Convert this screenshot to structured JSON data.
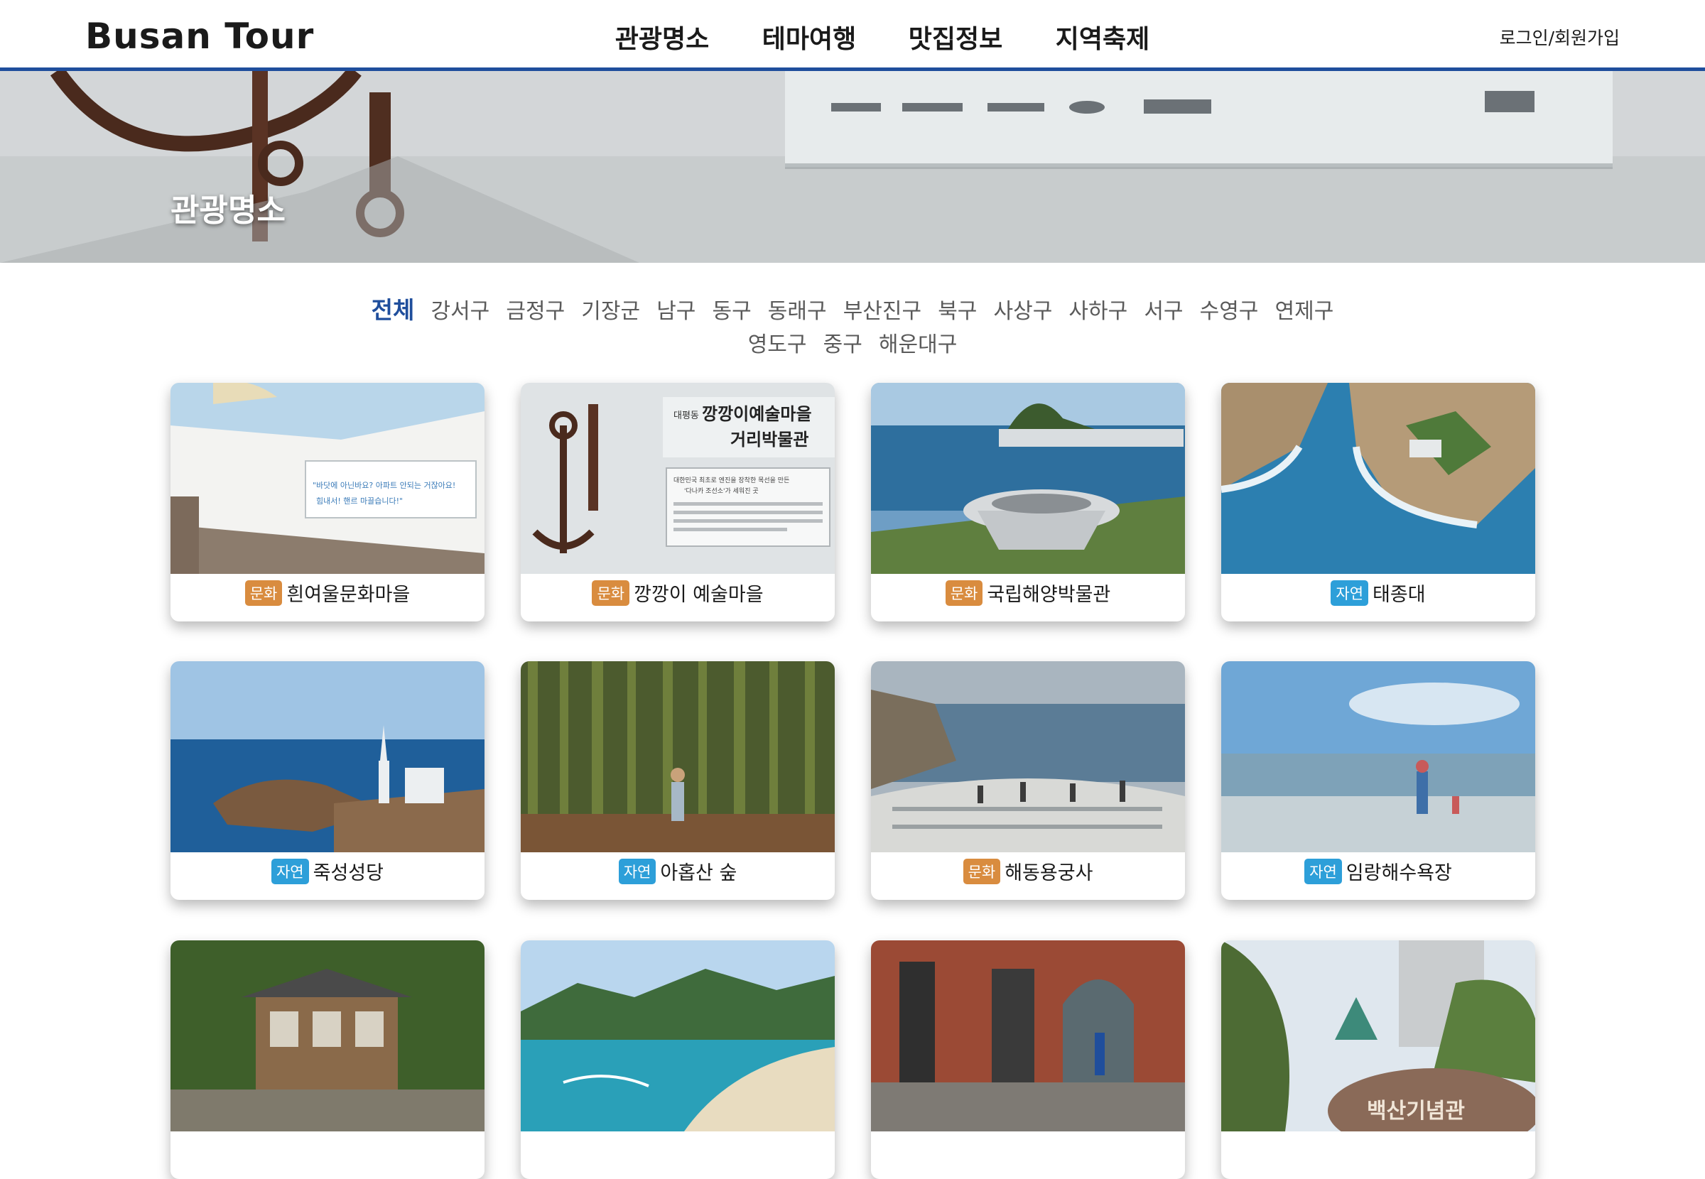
{
  "header": {
    "logo": "Busan Tour",
    "nav": [
      "관광명소",
      "테마여행",
      "맛집정보",
      "지역축제"
    ],
    "login": "로그인/회원가입"
  },
  "hero": {
    "title": "관광명소"
  },
  "filters": {
    "row1": [
      "전체",
      "강서구",
      "금정구",
      "기장군",
      "남구",
      "동구",
      "동래구",
      "부산진구",
      "북구",
      "사상구",
      "사하구",
      "서구",
      "수영구",
      "연제구"
    ],
    "row2": [
      "영도구",
      "중구",
      "해운대구"
    ],
    "active": "전체"
  },
  "places": [
    {
      "category": "문화",
      "name": "흰여울문화마을"
    },
    {
      "category": "문화",
      "name": "깡깡이 예술마을"
    },
    {
      "category": "문화",
      "name": "국립해양박물관"
    },
    {
      "category": "자연",
      "name": "태종대"
    },
    {
      "category": "자연",
      "name": "죽성성당"
    },
    {
      "category": "자연",
      "name": "아홉산 숲"
    },
    {
      "category": "문화",
      "name": "해동용궁사"
    },
    {
      "category": "자연",
      "name": "임랑해수욕장"
    }
  ],
  "thumbnail_text": {
    "sign_small": "대평동",
    "sign_title": "깡깡이예술마을",
    "sign_title2": "거리박물관",
    "sign_body1": "대한민국 최초로 엔진을 장착한 목선을 만든",
    "sign_body2": "'다나카 조선소'가 세워진 곳",
    "wall_line1": "\"바닷에 아닌바요? 아파트 안되는 거잖아요!",
    "wall_line2": "힘내서! 핸르 마끌습니다!\"",
    "memorial_stone": "백산기념관"
  },
  "colors": {
    "accent": "#1f4e9c",
    "culture_badge": "#d98c3f",
    "nature_badge": "#2d9fd9"
  }
}
